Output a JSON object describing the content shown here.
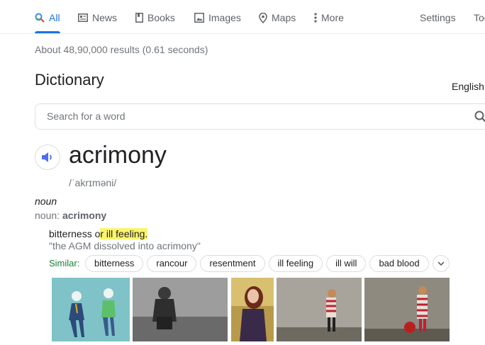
{
  "nav": {
    "tabs": [
      {
        "label": "All",
        "icon": "search-icon",
        "active": true
      },
      {
        "label": "News",
        "icon": "news-icon"
      },
      {
        "label": "Books",
        "icon": "book-icon"
      },
      {
        "label": "Images",
        "icon": "image-icon"
      },
      {
        "label": "Maps",
        "icon": "map-pin-icon"
      },
      {
        "label": "More",
        "icon": "more-vert-icon"
      }
    ],
    "settings": "Settings",
    "tools": "Tools"
  },
  "results": "About 48,90,000 results (0.61 seconds)",
  "dictionary": {
    "title": "Dictionary",
    "language": "English",
    "search_placeholder": "Search for a word",
    "word": "acrimony",
    "phonetic": "/ˈakrɪməni/",
    "part_of_speech": "noun",
    "noun_prefix": "noun: ",
    "noun_word": "acrimony",
    "definition_pre": "bitterness o",
    "definition_hl": "r ill feeling.",
    "example": "\"the AGM dissolved into acrimony\"",
    "similar_label": "Similar:",
    "similar": [
      "bitterness",
      "rancour",
      "resentment",
      "ill feeling",
      "ill will",
      "bad blood"
    ]
  },
  "colors": {
    "accent": "#1a73e8",
    "similar": "#188038",
    "highlight": "#fcf56b"
  }
}
